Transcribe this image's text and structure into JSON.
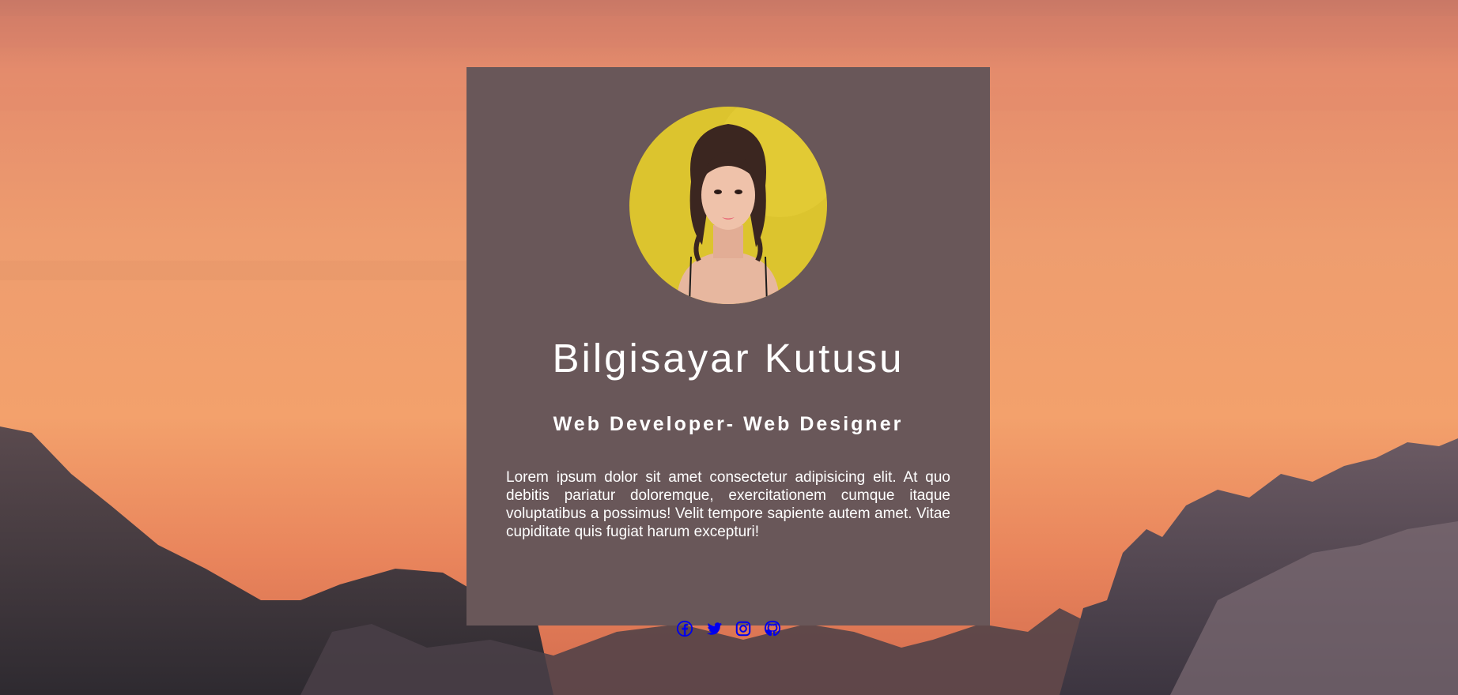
{
  "profile": {
    "name": "Bilgisayar Kutusu",
    "role": "Web Developer- Web Designer",
    "bio": "Lorem ipsum dolor sit amet consectetur adipisicing elit. At quo debitis pariatur doloremque, exercitationem cumque itaque voluptatibus a possimus! Velit tempore sapiente autem amet. Vitae cupiditate quis fugiat harum excepturi!"
  },
  "socials": [
    {
      "icon": "facebook-icon"
    },
    {
      "icon": "twitter-icon"
    },
    {
      "icon": "instagram-icon"
    },
    {
      "icon": "github-icon"
    }
  ],
  "colors": {
    "card_background": "#695759",
    "text": "#ffffff",
    "link": "#0000ee",
    "avatar_background": "#dcc42e"
  }
}
